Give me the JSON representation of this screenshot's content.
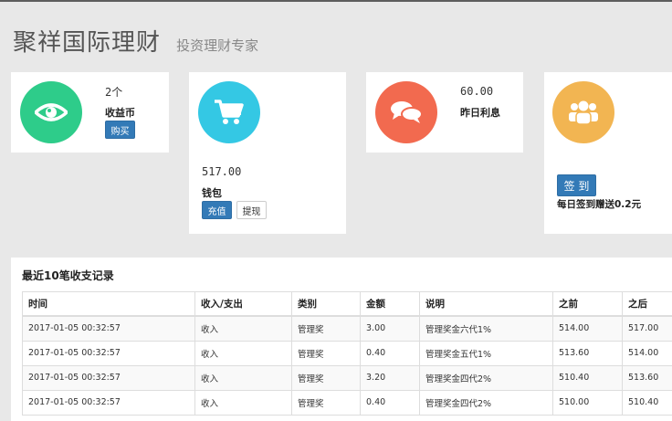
{
  "header": {
    "title": "聚祥国际理财",
    "subtitle": "投资理财专家"
  },
  "cards": {
    "coin": {
      "value": "2个",
      "label": "收益币",
      "button": "购买",
      "icon": "eye-icon",
      "color": "#2ecc8a"
    },
    "wallet": {
      "value": "517.00",
      "label": "钱包",
      "recharge": "充值",
      "withdraw": "提现",
      "icon": "cart-icon",
      "color": "#34c8e4"
    },
    "interest": {
      "value": "60.00",
      "label": "昨日利息",
      "icon": "chat-icon",
      "color": "#f26a4f"
    },
    "signin": {
      "button": "签 到",
      "label": "每日签到赠送0.2元",
      "icon": "users-icon",
      "color": "#f2b552"
    }
  },
  "records": {
    "title": "最近10笔收支记录",
    "columns": [
      "时间",
      "收入/支出",
      "类别",
      "金额",
      "说明",
      "之前",
      "之后"
    ],
    "rows": [
      [
        "2017-01-05 00:32:57",
        "收入",
        "管理奖",
        "3.00",
        "管理奖金六代1%",
        "514.00",
        "517.00"
      ],
      [
        "2017-01-05 00:32:57",
        "收入",
        "管理奖",
        "0.40",
        "管理奖金五代1%",
        "513.60",
        "514.00"
      ],
      [
        "2017-01-05 00:32:57",
        "收入",
        "管理奖",
        "3.20",
        "管理奖金四代2%",
        "510.40",
        "513.60"
      ],
      [
        "2017-01-05 00:32:57",
        "收入",
        "管理奖",
        "0.40",
        "管理奖金四代2%",
        "510.00",
        "510.40"
      ]
    ]
  }
}
